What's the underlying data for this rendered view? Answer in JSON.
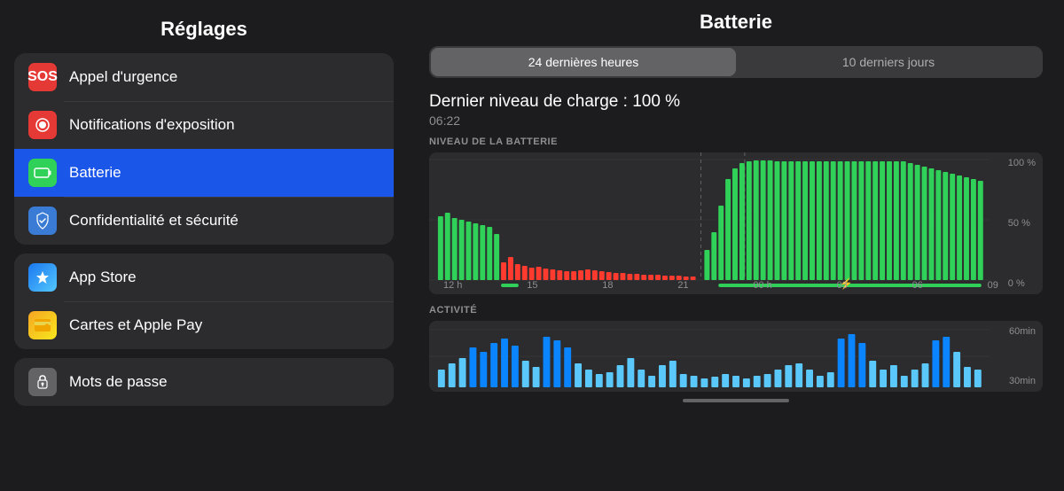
{
  "sidebar": {
    "title": "Réglages",
    "groups": [
      {
        "items": [
          {
            "id": "emergency",
            "label": "Appel d'urgence",
            "icon": "SOS",
            "icon_class": "icon-sos",
            "active": false
          },
          {
            "id": "exposure",
            "label": "Notifications d'exposition",
            "icon": "◉",
            "icon_class": "icon-notif",
            "active": false
          },
          {
            "id": "battery",
            "label": "Batterie",
            "icon": "▬",
            "icon_class": "icon-battery",
            "active": true
          },
          {
            "id": "privacy",
            "label": "Confidentialité et sécurité",
            "icon": "✋",
            "icon_class": "icon-privacy",
            "active": false
          }
        ]
      },
      {
        "items": [
          {
            "id": "appstore",
            "label": "App Store",
            "icon": "A",
            "icon_class": "icon-appstore",
            "active": false
          },
          {
            "id": "wallet",
            "label": "Cartes et Apple Pay",
            "icon": "▤",
            "icon_class": "icon-wallet",
            "active": false
          }
        ]
      },
      {
        "items": [
          {
            "id": "passwords",
            "label": "Mots de passe",
            "icon": "🔑",
            "icon_class": "icon-passwords",
            "active": false
          }
        ]
      }
    ]
  },
  "main": {
    "title": "Batterie",
    "tabs": [
      {
        "id": "24h",
        "label": "24 dernières heures",
        "active": true
      },
      {
        "id": "10d",
        "label": "10 derniers jours",
        "active": false
      }
    ],
    "battery_section": {
      "charge_label": "Dernier niveau de charge : 100 %",
      "charge_time": "06:22",
      "chart_label": "NIVEAU DE LA BATTERIE",
      "y_labels": [
        "100 %",
        "50 %",
        "0 %"
      ],
      "x_labels": [
        "12 h",
        "15",
        "18",
        "21",
        "00 h",
        "03",
        "06",
        "09"
      ]
    },
    "activity_section": {
      "label": "ACTIVITÉ",
      "y_labels": [
        "60min",
        "30min"
      ]
    },
    "scroll_bar_label": "scroll-indicator"
  }
}
